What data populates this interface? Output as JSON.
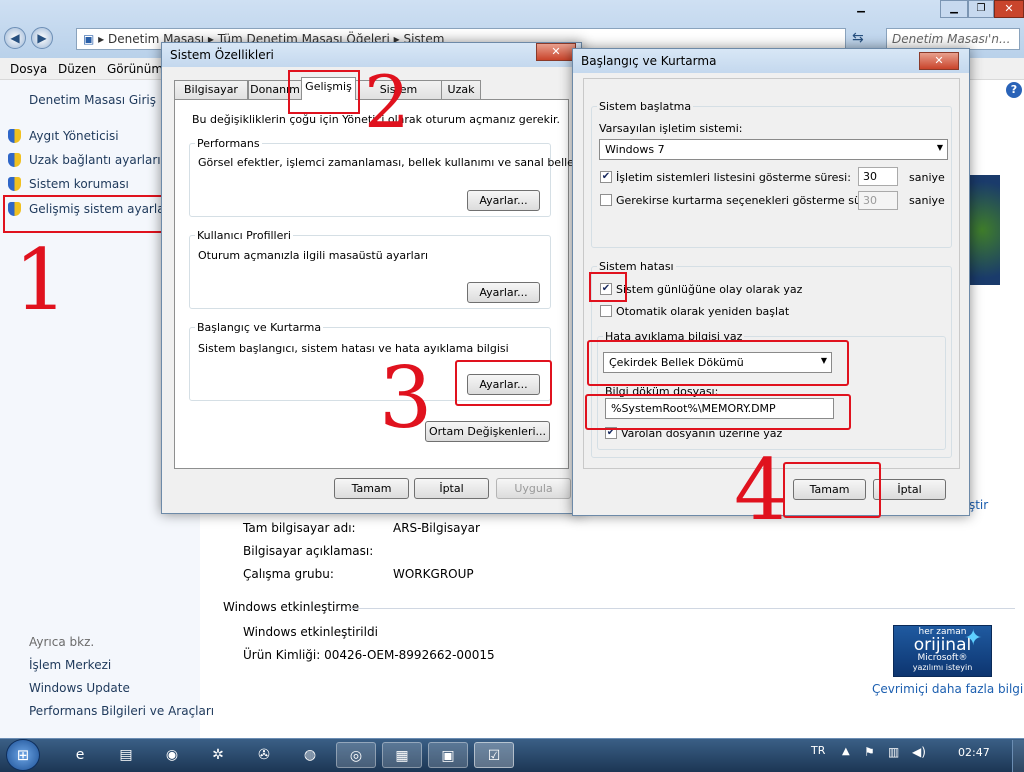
{
  "explorer": {
    "breadcrumb": [
      "Denetim Masası",
      "Tüm Denetim Masası Öğeleri",
      "Sistem"
    ],
    "search_placeholder": "Denetim Masası'n...",
    "menu": [
      "Dosya",
      "Düzen",
      "Görünüm"
    ],
    "home_link": "Denetim Masası Giriş",
    "tasks": [
      "Aygıt Yöneticisi",
      "Uzak bağlantı ayarları",
      "Sistem koruması",
      "Gelişmiş sistem ayarları"
    ],
    "see_also_title": "Ayrıca bkz.",
    "see_also": [
      "İşlem Merkezi",
      "Windows Update",
      "Performans Bilgileri ve Araçları"
    ],
    "computer_info": [
      {
        "label": "Tam bilgisayar adı:",
        "value": "ARS-Bilgisayar"
      },
      {
        "label": "Bilgisayar açıklaması:",
        "value": ""
      },
      {
        "label": "Çalışma grubu:",
        "value": "WORKGROUP"
      }
    ],
    "activation_title": "Windows etkinleştirme",
    "activation_status": "Windows etkinleştirildi",
    "product_id": "Ürün Kimliği: 00426-OEM-8992662-00015",
    "change_link": "ğiştir",
    "genuine_badge": {
      "top": "her zaman",
      "main": "orijinal",
      "brand": "Microsoft®",
      "sub": "yazılımı isteyin"
    },
    "more_info_link": "Çevrimiçi daha fazla bilgi..."
  },
  "sysprops": {
    "title": "Sistem Özellikleri",
    "tabs": [
      "Bilgisayar Adı",
      "Donanım",
      "Gelişmiş",
      "Sistem Koruması",
      "Uzak"
    ],
    "admin_note": "Bu değişikliklerin çoğu için Yönetici olarak oturum açmanız gerekir.",
    "performance": {
      "title": "Performans",
      "desc": "Görsel efektler, işlemci zamanlaması, bellek kullanımı ve sanal bellek",
      "button": "Ayarlar..."
    },
    "profiles": {
      "title": "Kullanıcı Profilleri",
      "desc": "Oturum açmanızla ilgili masaüstü ayarları",
      "button": "Ayarlar..."
    },
    "startup": {
      "title": "Başlangıç ve Kurtarma",
      "desc": "Sistem başlangıcı, sistem hatası ve hata ayıklama bilgisi",
      "button": "Ayarlar..."
    },
    "env_button": "Ortam Değişkenleri...",
    "ok": "Tamam",
    "cancel": "İptal",
    "apply": "Uygula"
  },
  "startup_dialog": {
    "title": "Başlangıç ve Kurtarma",
    "system_startup": "Sistem başlatma",
    "default_os_label": "Varsayılan işletim sistemi:",
    "default_os": "Windows 7",
    "show_os_list": "İşletim sistemleri listesini gösterme süresi:",
    "show_os_list_value": "30",
    "show_recovery": "Gerekirse kurtarma seçenekleri gösterme süresi:",
    "show_recovery_value": "30",
    "seconds": "saniye",
    "system_failure": "Sistem hatası",
    "write_event": "Sistem günlüğüne olay olarak yaz",
    "auto_restart": "Otomatik olarak yeniden başlat",
    "debug_group": "Hata ayıklama bilgisi yaz",
    "debug_type": "Çekirdek Bellek Dökümü",
    "dump_file_label": "Bilgi döküm dosyası:",
    "dump_file": "%SystemRoot%\\MEMORY.DMP",
    "overwrite": "Varolan dosyanın üzerine yaz",
    "ok": "Tamam",
    "cancel": "İptal"
  },
  "taskbar": {
    "lang": "TR",
    "time": "02:47"
  },
  "annotations": {
    "step1": "1",
    "step2": "2",
    "step3": "3",
    "step4": "4"
  },
  "colors": {
    "link": "#1e395b",
    "annotation": "#e0121e",
    "taskbar": "#1c3654"
  }
}
